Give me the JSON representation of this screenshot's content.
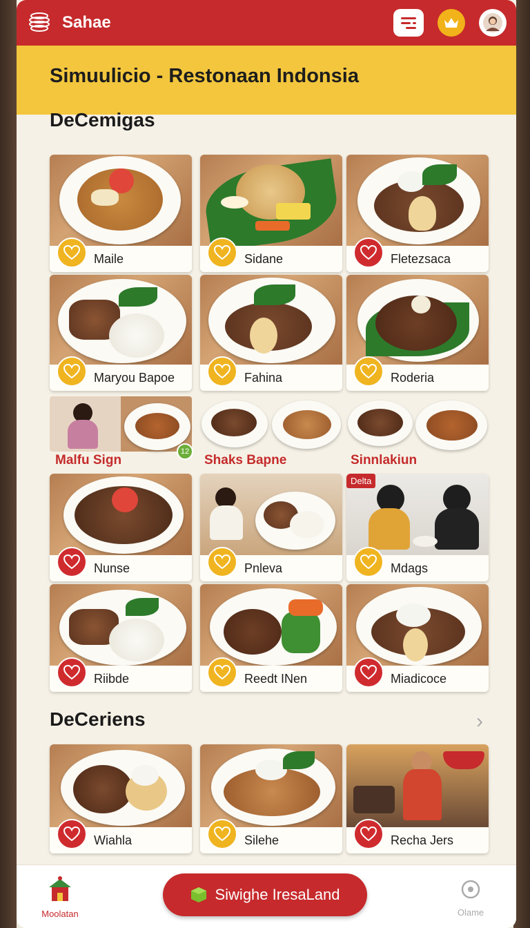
{
  "app": {
    "name": "Sahae"
  },
  "banner": {
    "title": "Simuulicio - Restonaan Indonsia"
  },
  "sections": [
    {
      "title": "DeCemigas"
    },
    {
      "title": "DeCeriens"
    }
  ],
  "grid1": [
    {
      "label": "Maile",
      "badge": "yellow"
    },
    {
      "label": "Sidane",
      "badge": "yellow"
    },
    {
      "label": "Fletezsaca",
      "badge": "red"
    },
    {
      "label": "Maryou Bapoe",
      "badge": "yellow"
    },
    {
      "label": "Fahina",
      "badge": "yellow"
    },
    {
      "label": "Roderia",
      "badge": "yellow"
    }
  ],
  "mini_row": [
    {
      "label": "Malfu Sign"
    },
    {
      "label": "Shaks Bapne"
    },
    {
      "label": "Sinnlakiun"
    }
  ],
  "mini_badge_number": "12",
  "grid2": [
    {
      "label": "Nunse",
      "badge": "red"
    },
    {
      "label": "Pnleva",
      "badge": "yellow"
    },
    {
      "label": "Mdags",
      "badge": "yellow",
      "tag": "Delta"
    },
    {
      "label": "Riibde",
      "badge": "red"
    },
    {
      "label": "Reedt INen",
      "badge": "yellow"
    },
    {
      "label": "Miadicoce",
      "badge": "red"
    }
  ],
  "grid3": [
    {
      "label": "Wiahla",
      "badge": "red"
    },
    {
      "label": "Silehe",
      "badge": "yellow"
    },
    {
      "label": "Recha Jers",
      "badge": "red"
    }
  ],
  "bottom": {
    "home_label": "Moolatan",
    "cta_label": "Siwighe IresaLand",
    "right_label": "Olame"
  },
  "icons": {
    "logo": "lantern-icon",
    "filter": "filter-icon",
    "crown": "crown-icon",
    "avatar": "avatar-icon",
    "heart": "heart-icon",
    "home": "restaurant-house-icon",
    "cta": "cube-icon",
    "more": "chat-icon"
  },
  "colors": {
    "primary": "#c62a2c",
    "accent": "#f3c63d",
    "badge_yellow": "#efb41f",
    "badge_red": "#cf2b2e"
  }
}
